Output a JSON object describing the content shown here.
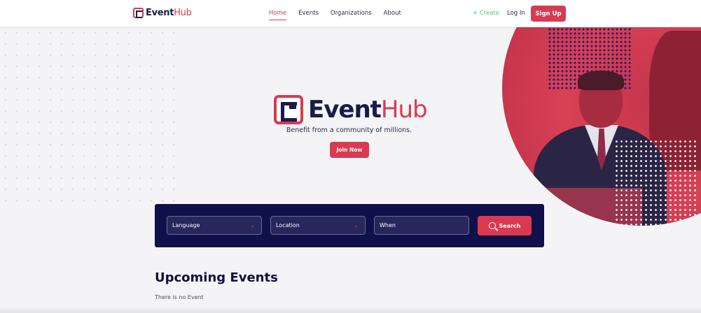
{
  "brand": {
    "name_part1": "Event",
    "name_part2": "Hub"
  },
  "nav": {
    "items": [
      {
        "label": "Home",
        "active": true
      },
      {
        "label": "Events",
        "active": false
      },
      {
        "label": "Organizations",
        "active": false
      },
      {
        "label": "About",
        "active": false
      }
    ],
    "create_label": "+ Create",
    "login_label": "Log In",
    "signup_label": "Sign Up"
  },
  "hero": {
    "tagline": "Benefit from a community of millions.",
    "join_label": "Join Now"
  },
  "search": {
    "language_label": "Language",
    "location_label": "Location",
    "when_placeholder": "When",
    "search_label": "Search"
  },
  "upcoming": {
    "title": "Upcoming Events",
    "empty_text": "There is no Event"
  },
  "colors": {
    "accent": "#d93a52",
    "navy": "#10104a",
    "create_green": "#5cc07a"
  },
  "icons": [
    "chevron-down-icon",
    "search-icon"
  ]
}
